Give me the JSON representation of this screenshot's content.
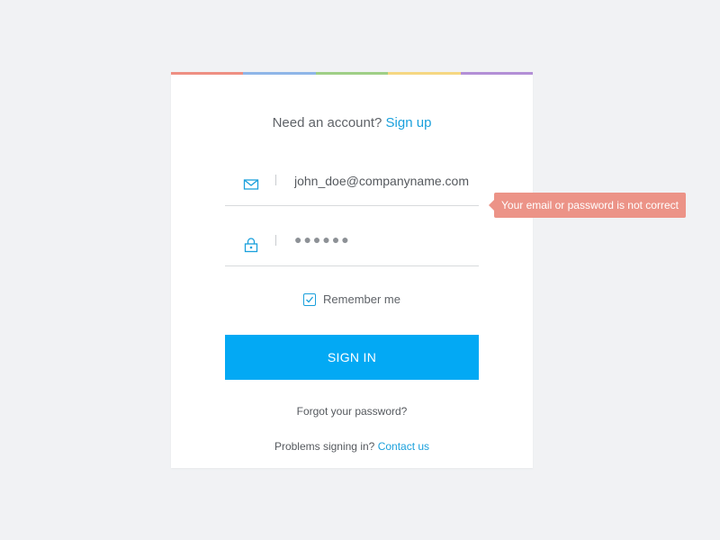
{
  "colors": {
    "stripe": [
      "#ee8f83",
      "#8fb6e8",
      "#9fcf86",
      "#f6d782",
      "#b38fd6"
    ],
    "accent": "#03a9f4",
    "link": "#1aa0dc",
    "error": "#ec9387"
  },
  "header": {
    "prompt": "Need an account?",
    "signup_link": "Sign up"
  },
  "email_field": {
    "icon": "envelope-icon",
    "value": "john_doe@companyname.com"
  },
  "password_field": {
    "icon": "lock-icon",
    "masked_value": "●●●●●●"
  },
  "remember": {
    "label": "Remember me",
    "checked": true
  },
  "signin_button": {
    "label": "SIGN IN"
  },
  "forgot": {
    "label": "Forgot your password?"
  },
  "problems": {
    "prompt": "Problems signing in?",
    "contact_link": "Contact us"
  },
  "error": {
    "message": "Your email or password is not correct"
  }
}
